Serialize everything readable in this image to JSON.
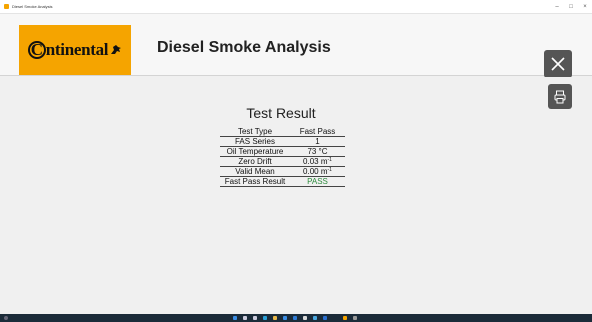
{
  "window": {
    "title": "Diesel Smoke Analysis",
    "controls": {
      "minimize": "–",
      "maximize": "□",
      "close": "×"
    }
  },
  "header": {
    "logo_text": "ntinental",
    "logo_c": "C",
    "title": "Diesel Smoke Analysis"
  },
  "colors": {
    "brand": "#f5a400",
    "button": "#555555",
    "pass": "#2e8b3e"
  },
  "result": {
    "title": "Test Result",
    "rows": [
      {
        "label": "Test Type",
        "value": "Fast Pass"
      },
      {
        "label": "FAS Series",
        "value": "1"
      },
      {
        "label": "Oil Temperature",
        "value": "73 °C"
      },
      {
        "label": "Zero Drift",
        "value": "0.03 m",
        "unit_sup": "-1"
      },
      {
        "label": "Valid Mean",
        "value": "0.00 m",
        "unit_sup": "-1"
      },
      {
        "label": "Fast Pass Result",
        "value": "PASS"
      }
    ]
  },
  "icons": {
    "close": "close-icon",
    "print": "printer-icon",
    "horse": "horse-icon"
  }
}
